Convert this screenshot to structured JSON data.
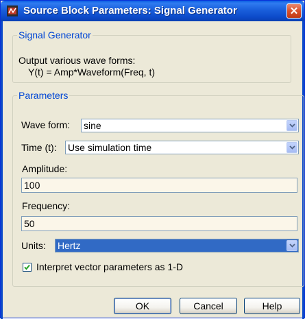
{
  "window": {
    "title": "Source Block Parameters: Signal Generator",
    "close_glyph": "✕"
  },
  "block_group": {
    "legend": "Signal Generator",
    "description_line1": "Output various wave forms:",
    "description_line2": "Y(t) = Amp*Waveform(Freq, t)"
  },
  "params": {
    "legend": "Parameters",
    "wave_form": {
      "label": "Wave form:",
      "value": "sine"
    },
    "time": {
      "label": "Time (t):",
      "value": "Use simulation time"
    },
    "amplitude": {
      "label": "Amplitude:",
      "value": "100"
    },
    "frequency": {
      "label": "Frequency:",
      "value": "50"
    },
    "units": {
      "label": "Units:",
      "value": "Hertz"
    },
    "interpret_checkbox": {
      "label": "Interpret vector parameters as 1-D",
      "checked": true
    }
  },
  "buttons": {
    "ok": "OK",
    "cancel": "Cancel",
    "help": "Help"
  },
  "colors": {
    "titlebar": "#0c4ac9",
    "legend_text": "#0046d5",
    "selection": "#316ac5",
    "field_background": "#fbf6e9"
  }
}
